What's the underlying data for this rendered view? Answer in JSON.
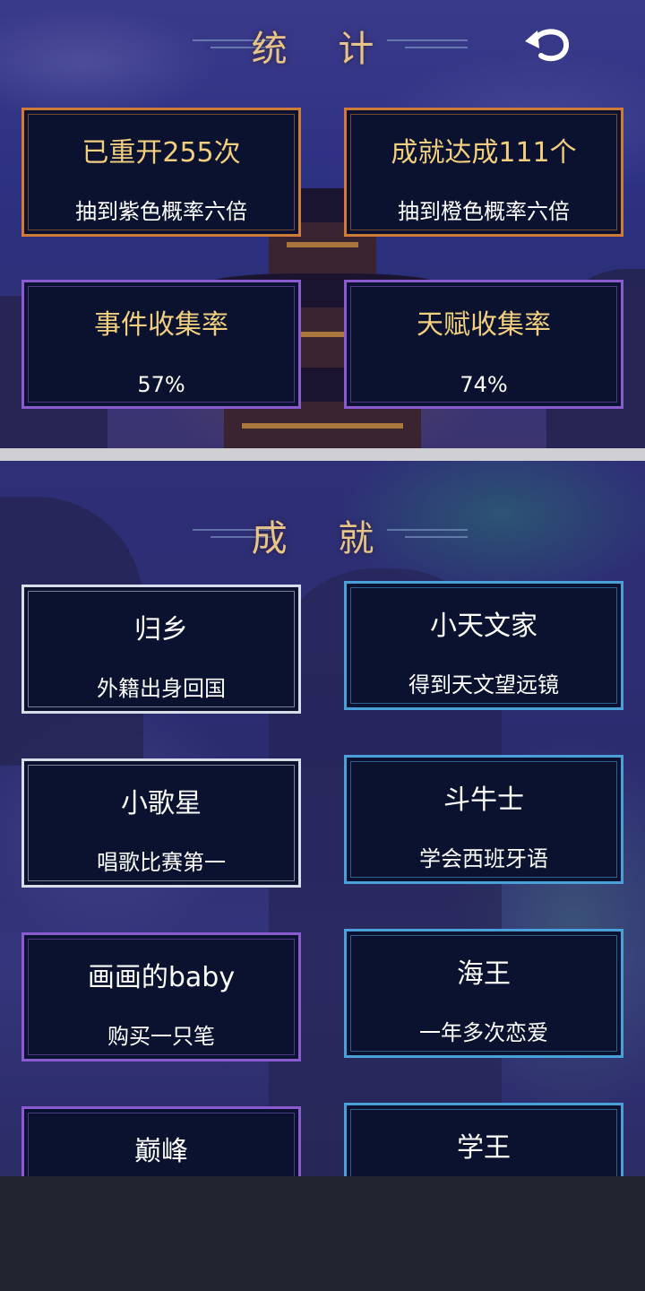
{
  "stats": {
    "title": "统 计",
    "cards": [
      {
        "title": "已重开255次",
        "sub": "抽到紫色概率六倍",
        "color": "#d07a3a"
      },
      {
        "title": "成就达成111个",
        "sub": "抽到橙色概率六倍",
        "color": "#d07a3a"
      },
      {
        "title": "事件收集率",
        "sub": "57%",
        "color": "#8a5ad0"
      },
      {
        "title": "天赋收集率",
        "sub": "74%",
        "color": "#8a5ad0"
      }
    ]
  },
  "achievements": {
    "title": "成 就",
    "items": [
      {
        "title": "归乡",
        "sub": "外籍出身回国",
        "color": "#d8dce8"
      },
      {
        "title": "小天文家",
        "sub": "得到天文望远镜",
        "color": "#4aa0d8"
      },
      {
        "title": "小歌星",
        "sub": "唱歌比赛第一",
        "color": "#d8dce8"
      },
      {
        "title": "斗牛士",
        "sub": "学会西班牙语",
        "color": "#4aa0d8"
      },
      {
        "title": "画画的baby",
        "sub": "购买一只笔",
        "color": "#8a5ad0"
      },
      {
        "title": "海王",
        "sub": "一年多次恋爱",
        "color": "#4aa0d8"
      },
      {
        "title": "巅峰",
        "sub": "",
        "color": "#8a5ad0"
      },
      {
        "title": "学王",
        "sub": "",
        "color": "#4aa0d8"
      }
    ]
  },
  "icons": {
    "back": "back-arrow-icon"
  },
  "colors": {
    "title_gold": "#e7c48a",
    "card_bg": "#0a1230",
    "stat_title": "#f2cf7e"
  }
}
